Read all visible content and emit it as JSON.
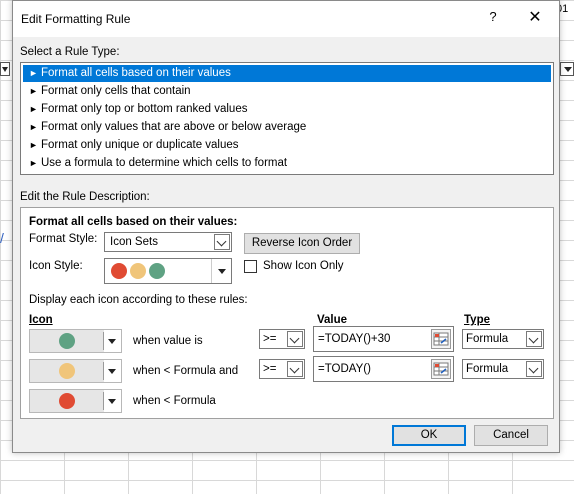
{
  "background": {
    "cell_text": "01"
  },
  "dialog": {
    "title": "Edit Formatting Rule",
    "help": "?",
    "close": "✕",
    "select_rule_type_label": "Select a Rule Type:",
    "rule_types": [
      "Format all cells based on their values",
      "Format only cells that contain",
      "Format only top or bottom ranked values",
      "Format only values that are above or below average",
      "Format only unique or duplicate values",
      "Use a formula to determine which cells to format"
    ],
    "selected_rule_index": 0,
    "edit_description_label": "Edit the Rule Description:",
    "description_heading": "Format all cells based on their values:",
    "format_style_label": "Format Style:",
    "format_style_value": "Icon Sets",
    "reverse_icon_order": "Reverse Icon Order",
    "icon_style_label": "Icon Style:",
    "show_icon_only": "Show Icon Only",
    "show_icon_only_checked": false,
    "display_rules_label": "Display each icon according to these rules:",
    "columns": {
      "icon": "Icon",
      "value": "Value",
      "type": "Type"
    },
    "icon_rules": [
      {
        "color": "#5fa283",
        "condition_text": "when value is",
        "operator": ">=",
        "value": "=TODAY()+30",
        "type": "Formula"
      },
      {
        "color": "#f0c57a",
        "condition_text": "when < Formula and",
        "operator": ">=",
        "value": "=TODAY()",
        "type": "Formula"
      },
      {
        "color": "#e04b33",
        "condition_text": "when < Formula"
      }
    ],
    "icon_style_colors": [
      "#e04b33",
      "#f0c57a",
      "#5fa283"
    ],
    "ok": "OK",
    "cancel": "Cancel"
  }
}
